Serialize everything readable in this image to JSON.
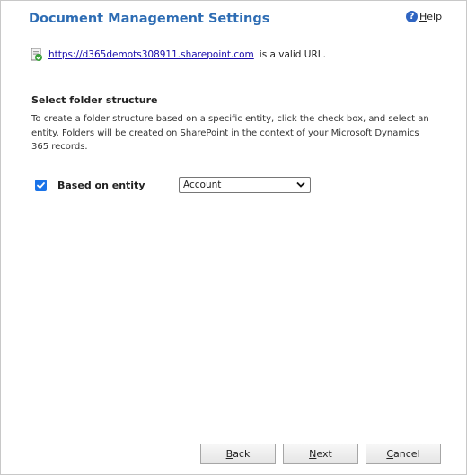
{
  "dialog": {
    "title": "Document Management Settings",
    "help_label_first": "H",
    "help_label_rest": "elp"
  },
  "url_status": {
    "url": "https://d365demots308911.sharepoint.com",
    "suffix": "is a valid URL."
  },
  "folder_structure": {
    "heading": "Select folder structure",
    "description": "To create a folder structure based on a specific entity, click the check box, and select an entity. Folders will be created on SharePoint in the context of your Microsoft Dynamics 365 records.",
    "based_on_entity_label": "Based on entity",
    "based_on_entity_checked": true,
    "entity_selected": "Account"
  },
  "buttons": {
    "back_first": "B",
    "back_rest": "ack",
    "next_first": "N",
    "next_rest": "ext",
    "cancel_first": "C",
    "cancel_rest": "ancel"
  },
  "colors": {
    "title": "#2e6db4",
    "link": "#1a0dab",
    "checkbox": "#1a73e8"
  },
  "icons": [
    "help-icon",
    "sharepoint-site-icon",
    "check-icon",
    "chevron-down-icon"
  ]
}
